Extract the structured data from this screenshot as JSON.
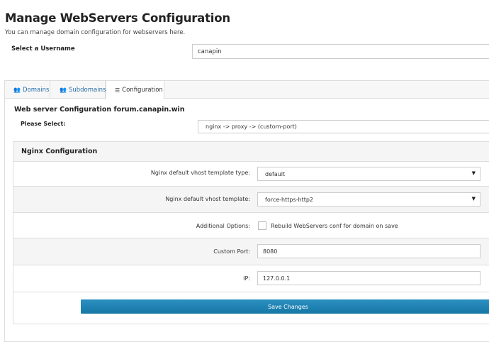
{
  "page": {
    "title": "Manage WebServers Configuration",
    "subtitle": "You can manage domain configuration for webservers here."
  },
  "username": {
    "label": "Select a Username",
    "value": "canapin"
  },
  "tabs": [
    {
      "label": "Domains",
      "icon": "users-icon",
      "active": false
    },
    {
      "label": "Subdomains",
      "icon": "users-icon",
      "active": false
    },
    {
      "label": "Configuration",
      "icon": "sliders-icon",
      "active": true
    }
  ],
  "config": {
    "title": "Web server Configuration forum.canapin.win",
    "please_select_label": "Please Select:",
    "please_select_value": "nginx -> proxy -> (custom-port)"
  },
  "nginx": {
    "title": "Nginx Configuration",
    "template_type_label": "Nginx default vhost template type:",
    "template_type_value": "default",
    "template_label": "Nginx default vhost template:",
    "template_value": "force-https-http2",
    "additional_options_label": "Additional Options:",
    "rebuild_label": "Rebuild WebServers conf for domain on save",
    "rebuild_checked": false,
    "custom_port_label": "Custom Port:",
    "custom_port_value": "8080",
    "ip_label": "IP:",
    "ip_value": "127.0.0.1",
    "save_label": "Save Changes"
  },
  "colors": {
    "accent": "#1e81b0",
    "link": "#2a6ea6"
  }
}
